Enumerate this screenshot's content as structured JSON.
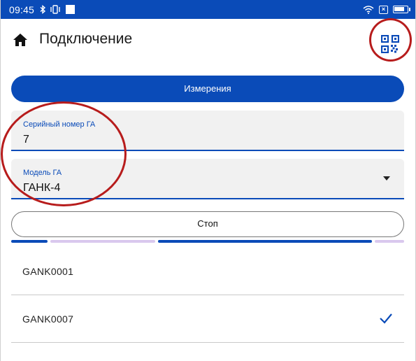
{
  "status_bar": {
    "time": "09:45",
    "icons": [
      "bluetooth-icon",
      "vibrate-icon",
      "notification-square-icon",
      "wifi-icon",
      "sim-off-icon",
      "battery-icon"
    ],
    "battery_level": 0.85
  },
  "header": {
    "title": "Подключение",
    "left_icon": "home-icon",
    "right_icon": "qr-scan-icon"
  },
  "measurements_button": {
    "label": "Измерения"
  },
  "serial_field": {
    "label": "Серийный номер ГА",
    "value": "7"
  },
  "model_field": {
    "label": "Модель ГА",
    "value": "ГАНК-4"
  },
  "stop_button": {
    "label": "Стоп"
  },
  "devices": [
    {
      "name": "GANK0001",
      "selected": false
    },
    {
      "name": "GANK0007",
      "selected": true
    }
  ],
  "colors": {
    "primary": "#0a4bb8",
    "annotation": "#b71c1c",
    "progress_track": "#d9c8ee"
  }
}
